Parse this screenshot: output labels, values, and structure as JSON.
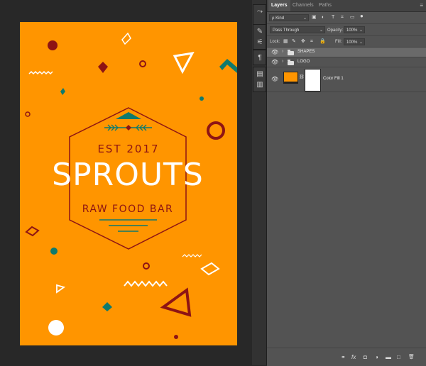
{
  "canvas": {
    "background": "#282828",
    "artboard_color": "#ff9500",
    "logo": {
      "est": "EST 2017",
      "name": "SPROUTS",
      "tagline": "RAW FOOD BAR"
    },
    "colors": {
      "dark_red": "#8e1414",
      "teal": "#0f7a6d",
      "white": "#ffffff"
    }
  },
  "toolstrip": {
    "icons": [
      "move-icon",
      "brush-settings-icon",
      "adjustments-icon",
      "paragraph-icon",
      "properties-icon",
      "libraries-icon"
    ]
  },
  "layers_panel": {
    "tabs": [
      {
        "label": "Layers",
        "active": true
      },
      {
        "label": "Channels",
        "active": false
      },
      {
        "label": "Paths",
        "active": false
      }
    ],
    "filter": {
      "label": "ρ Kind"
    },
    "blend_mode": "Pass Through",
    "opacity_label": "Opacity:",
    "opacity_value": "100%",
    "lock_label": "Lock:",
    "fill_label": "Fill:",
    "fill_value": "100%",
    "layers": [
      {
        "name": "SHAPES",
        "type": "group",
        "selected": true
      },
      {
        "name": "LOGO",
        "type": "group",
        "selected": false
      },
      {
        "name": "Color Fill 1",
        "type": "fill",
        "selected": false,
        "swatch": "#ff9500"
      }
    ],
    "bottom_icons": [
      "link-icon",
      "fx-icon",
      "mask-icon",
      "adjustment-icon",
      "folder-icon",
      "new-layer-icon",
      "trash-icon"
    ],
    "bottom_labels": {
      "link": "⚭",
      "fx": "fx",
      "mask": "◘",
      "adjust": "◑",
      "folder": "▬",
      "newlayer": "□",
      "trash": "🗑"
    }
  }
}
